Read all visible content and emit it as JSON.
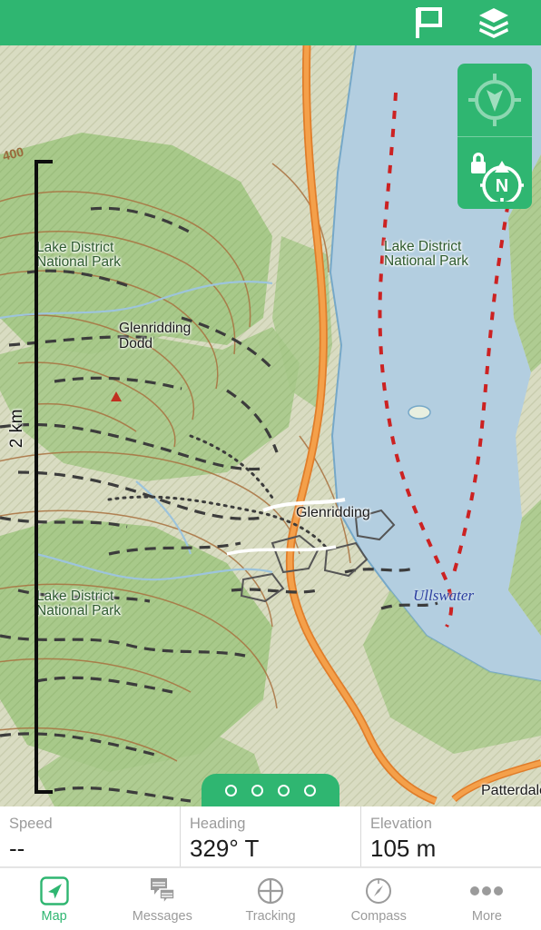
{
  "header": {
    "flag_icon": "flag-icon",
    "layers_icon": "layers-icon"
  },
  "map": {
    "scale_label": "2 km",
    "contour_label": "400",
    "labels": [
      {
        "text": "Lake District\nNational Park",
        "kind": "park"
      },
      {
        "text": "Glenridding\nDodd",
        "kind": "peak"
      },
      {
        "text": "Lake District\nNational Park",
        "kind": "park"
      },
      {
        "text": "Lake District\nNational Park",
        "kind": "park"
      },
      {
        "text": "Glenridding",
        "kind": "town"
      },
      {
        "text": "Ullswater",
        "kind": "water"
      },
      {
        "text": "Patterdale",
        "kind": "town"
      }
    ],
    "controls": {
      "locate_icon": "gps-crosshair-icon",
      "orientation_icon": "north-lock-compass-icon",
      "north_letter": "N"
    },
    "page_dots": 4,
    "colors": {
      "accent": "#2fb671",
      "water": "#b3cee0",
      "vegetation": "#a8c98a",
      "open_land": "#d9dcc2",
      "road": "#f09236",
      "contour": "#a9713f",
      "boundary": "#cc2222"
    }
  },
  "data_strip": {
    "cells": [
      {
        "label": "Speed",
        "value": "--"
      },
      {
        "label": "Heading",
        "value": "329° T"
      },
      {
        "label": "Elevation",
        "value": "105 m"
      }
    ]
  },
  "tabbar": {
    "items": [
      {
        "label": "Map",
        "icon": "navigation-arrow-icon",
        "active": true
      },
      {
        "label": "Messages",
        "icon": "chat-bubbles-icon",
        "active": false
      },
      {
        "label": "Tracking",
        "icon": "crosshair-circle-icon",
        "active": false
      },
      {
        "label": "Compass",
        "icon": "compass-icon",
        "active": false
      },
      {
        "label": "More",
        "icon": "ellipsis-icon",
        "active": false
      }
    ]
  }
}
